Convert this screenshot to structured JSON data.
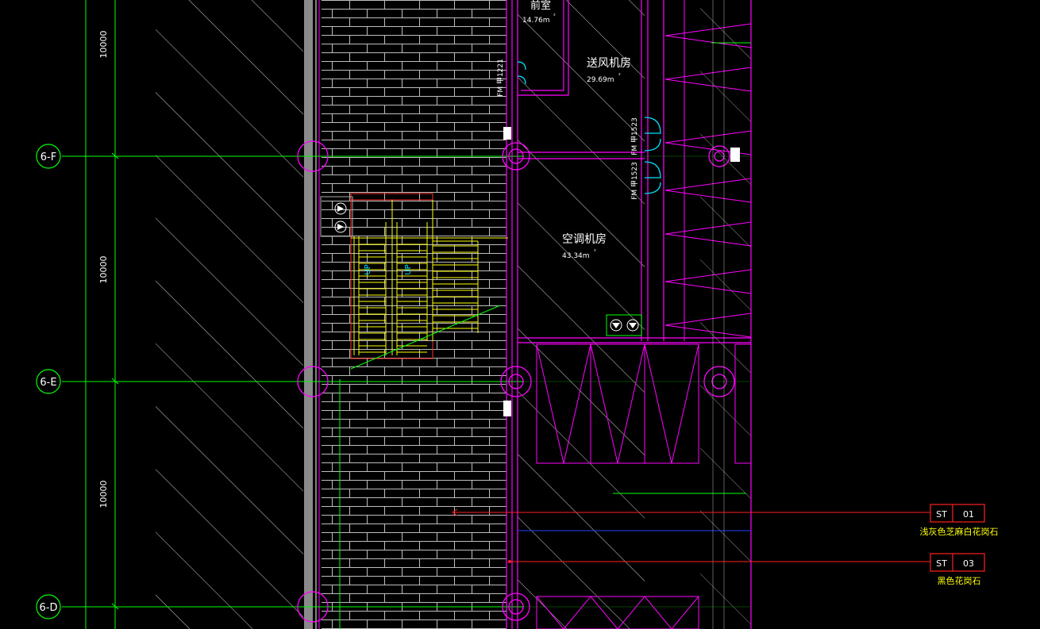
{
  "drawing": {
    "colors": {
      "background": "#000000",
      "grid": "#00ff00",
      "wall": "#ff00ff",
      "hatch": "#ffffff",
      "brick": "#d0d0d0",
      "stair": "#ffff00",
      "leader": "#ff2020",
      "cyan": "#00e0ff",
      "blue": "#2040ff",
      "grey": "#8a8a8a",
      "label_yellow": "#ffff00"
    },
    "grid_axes": [
      {
        "label": "6-F"
      },
      {
        "label": "6-E"
      },
      {
        "label": "6-D"
      }
    ],
    "dimensions": [
      "10000",
      "10000",
      "10000"
    ],
    "rooms": [
      {
        "name": "送风机房",
        "area": "29.69m",
        "sup": "²"
      },
      {
        "name": "空调机房",
        "area": "43.34m",
        "sup": "²"
      },
      {
        "name": "前室",
        "area": "14.76m",
        "sup": "²"
      }
    ],
    "doors": [
      "FM 甲1221",
      "FM 甲1523",
      "FM 甲1523"
    ],
    "stair_labels": [
      "UP",
      "UP"
    ],
    "material_tags": [
      {
        "code": "ST",
        "number": "01",
        "desc": "浅灰色芝麻白花岗石"
      },
      {
        "code": "ST",
        "number": "03",
        "desc": "黑色花岗石"
      }
    ]
  }
}
